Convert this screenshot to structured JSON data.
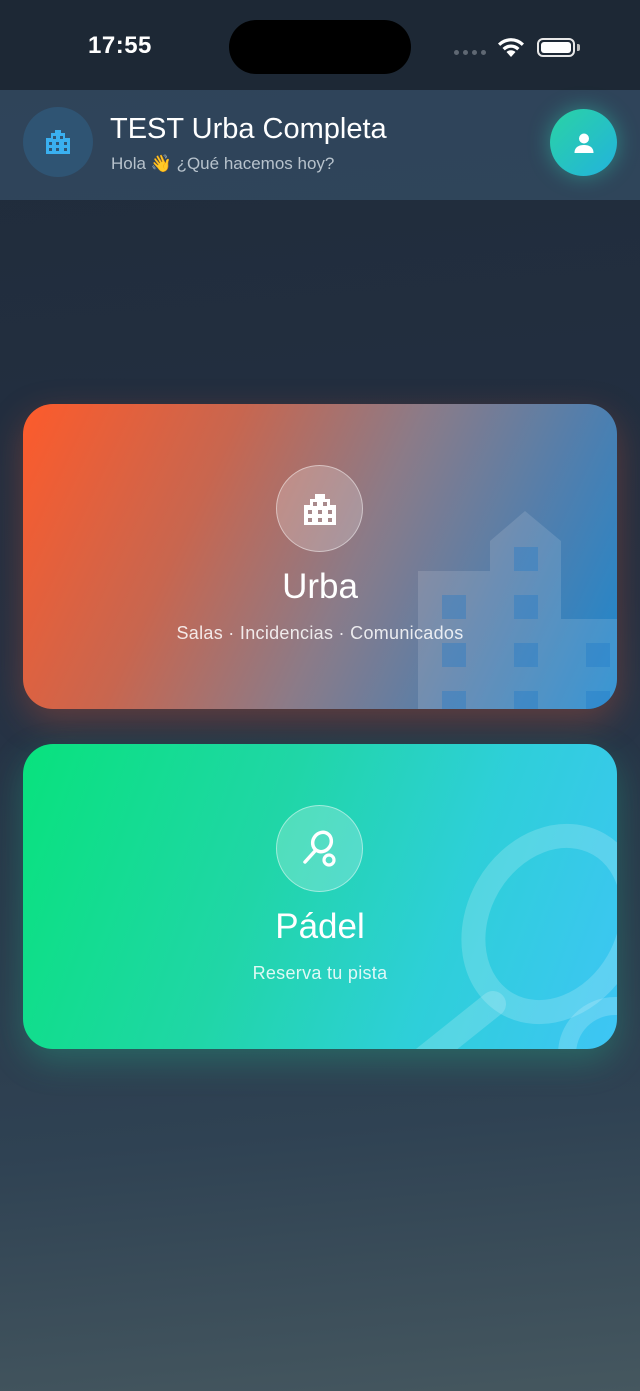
{
  "status_bar": {
    "time": "17:55",
    "icons": [
      "cellular-signal-icon",
      "wifi-icon",
      "battery-icon"
    ]
  },
  "header": {
    "logo_icon": "building-icon",
    "title": "TEST Urba Completa",
    "greeting": "Hola 👋 ¿Qué hacemos hoy?",
    "profile_icon": "person-icon"
  },
  "cards": [
    {
      "id": "urba",
      "icon": "building-icon",
      "title": "Urba",
      "subtitle": "Salas · Incidencias · Comunicados",
      "gradient_colors": [
        "#fd5b2b",
        "#1b88cf"
      ]
    },
    {
      "id": "padel",
      "icon": "padel-racket-icon",
      "title": "Pádel",
      "subtitle": "Reserva tu pista",
      "gradient_colors": [
        "#08e27d",
        "#3ec5f5"
      ]
    }
  ],
  "colors": {
    "background": "#243042",
    "header_bg": "#2f4a60",
    "profile_accent": "#22c7b8",
    "logo_accent": "#3ab0f0"
  }
}
